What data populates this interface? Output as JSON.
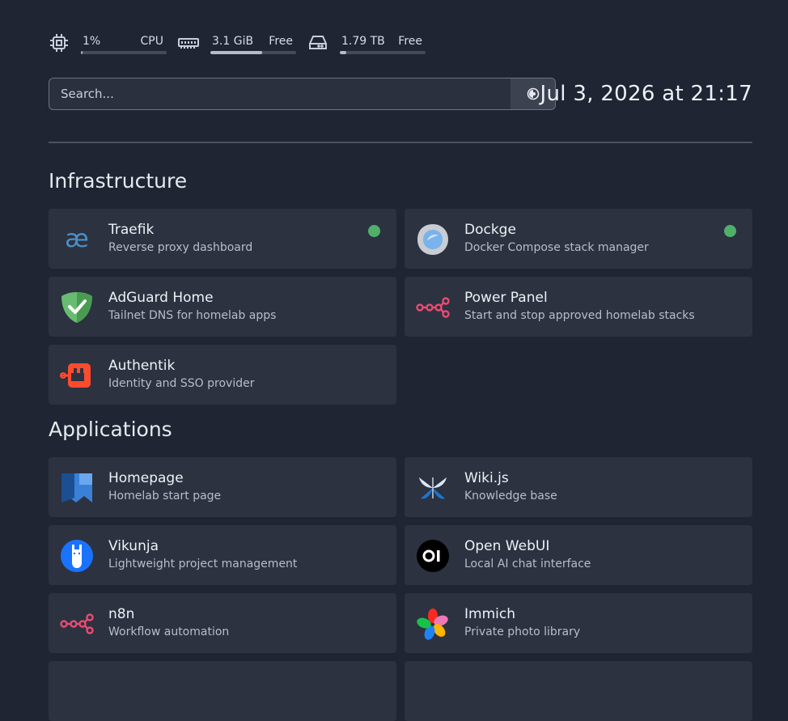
{
  "resources": [
    {
      "icon": "cpu-icon",
      "value": "1%",
      "label": "CPU",
      "fill": 0.01
    },
    {
      "icon": "memory-icon",
      "value": "3.1 GiB",
      "label": "Free",
      "fill": 0.6
    },
    {
      "icon": "disk-icon",
      "value": "1.79 TB",
      "label": "Free",
      "fill": 0.08
    }
  ],
  "search": {
    "placeholder": "Search..."
  },
  "clock": "Jul 3, 2026 at 21:17",
  "sections": [
    {
      "title": "Infrastructure",
      "services": [
        {
          "name": "Traefik",
          "description": "Reverse proxy dashboard",
          "icon": "traefik-icon",
          "status": "online"
        },
        {
          "name": "Dockge",
          "description": "Docker Compose stack manager",
          "icon": "dockge-icon",
          "status": "online"
        },
        {
          "name": "AdGuard Home",
          "description": "Tailnet DNS for homelab apps",
          "icon": "adguard-icon"
        },
        {
          "name": "Power Panel",
          "description": "Start and stop approved homelab stacks",
          "icon": "n8n-icon"
        },
        {
          "name": "Authentik",
          "description": "Identity and SSO provider",
          "icon": "authentik-icon"
        }
      ]
    },
    {
      "title": "Applications",
      "services": [
        {
          "name": "Homepage",
          "description": "Homelab start page",
          "icon": "homepage-icon"
        },
        {
          "name": "Wiki.js",
          "description": "Knowledge base",
          "icon": "wikijs-icon"
        },
        {
          "name": "Vikunja",
          "description": "Lightweight project management",
          "icon": "vikunja-icon"
        },
        {
          "name": "Open WebUI",
          "description": "Local AI chat interface",
          "icon": "openwebui-icon"
        },
        {
          "name": "n8n",
          "description": "Workflow automation",
          "icon": "n8n-icon"
        },
        {
          "name": "Immich",
          "description": "Private photo library",
          "icon": "immich-icon"
        }
      ]
    }
  ],
  "colors": {
    "background": "#1f2533",
    "card": "#2c3240",
    "status_online": "#50b06a"
  }
}
